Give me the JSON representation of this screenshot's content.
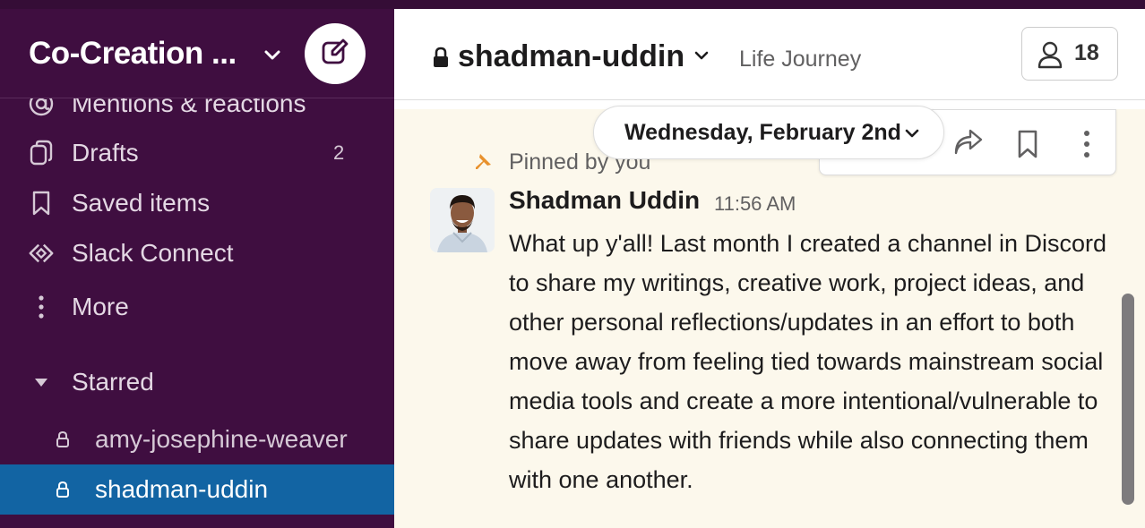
{
  "workspace": {
    "name": "Co-Creation ...",
    "compose_icon": "compose-icon"
  },
  "sidebar": {
    "nav": [
      {
        "label": "Mentions & reactions",
        "icon": "at-icon"
      },
      {
        "label": "Drafts",
        "icon": "drafts-icon",
        "count": "2"
      },
      {
        "label": "Saved items",
        "icon": "bookmark-icon"
      },
      {
        "label": "Slack Connect",
        "icon": "slack-connect-icon"
      },
      {
        "label": "More",
        "icon": "more-vertical-icon"
      }
    ],
    "section": {
      "label": "Starred",
      "icon": "caret-down-icon"
    },
    "channels": [
      {
        "label": "amy-josephine-weaver",
        "private": true,
        "active": false
      },
      {
        "label": "shadman-uddin",
        "private": true,
        "active": true
      }
    ]
  },
  "channel": {
    "name": "shadman-uddin",
    "topic": "Life Journey",
    "members_count": "18"
  },
  "date_divider": {
    "label": "Wednesday, February 2nd"
  },
  "message": {
    "pinned_label": "Pinned by you",
    "author": "Shadman Uddin",
    "time": "11:56 AM",
    "text": "What up y'all! Last month I created a channel in Discord to share my writings, creative work, project ideas, and other personal reflections/updates in an effort to both move away from feeling tied towards mainstream social media tools and create a more intentional/vulnerable to share updates with friends while also connecting them with one another."
  },
  "colors": {
    "sidebar_bg": "#3f0e40",
    "active_channel": "#1264a3",
    "pinned_highlight": "#fcf8ec",
    "pin_icon": "#e8912d"
  }
}
